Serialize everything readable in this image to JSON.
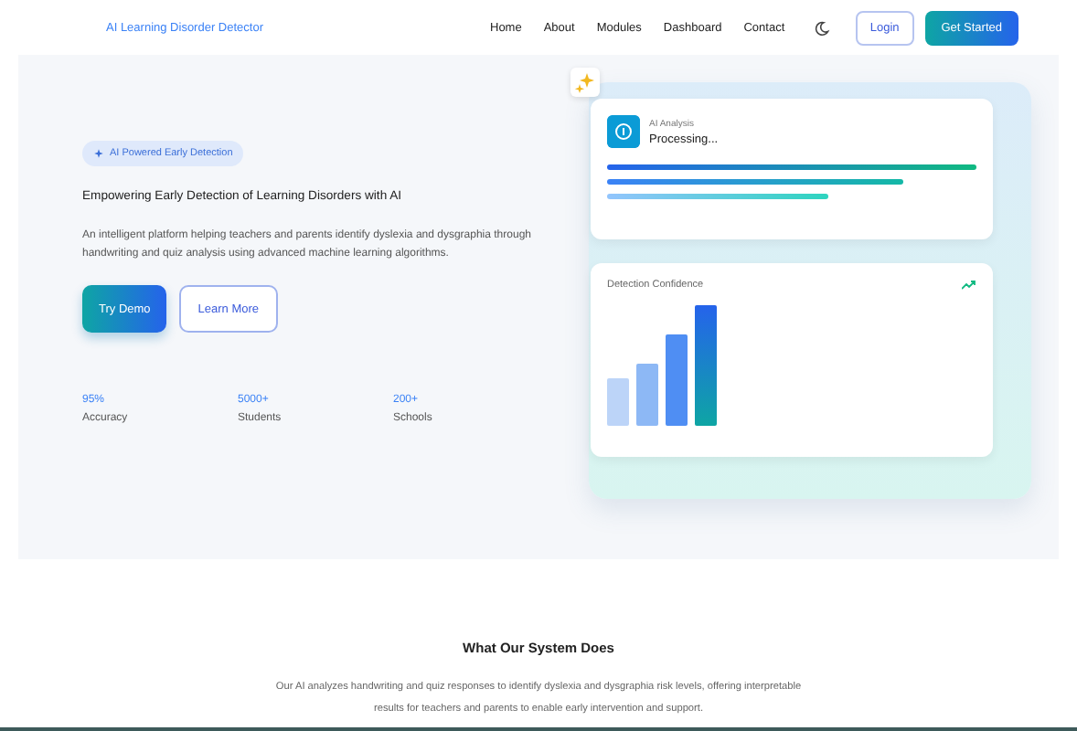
{
  "nav": {
    "brand": "AI Learning Disorder Detector",
    "links": [
      "Home",
      "About",
      "Modules",
      "Dashboard",
      "Contact"
    ],
    "login": "Login",
    "cta": "Get Started"
  },
  "hero": {
    "badge": "AI Powered Early Detection",
    "title": "Empowering Early Detection of Learning Disorders with AI",
    "description": "An intelligent platform helping teachers and parents identify dyslexia and dysgraphia through handwriting and quiz analysis using advanced machine learning algorithms.",
    "buttons": [
      "Try Demo",
      "Learn More"
    ],
    "stats": [
      {
        "value": "95%",
        "label": "Accuracy"
      },
      {
        "value": "5000+",
        "label": "Students"
      },
      {
        "value": "200+",
        "label": "Schools"
      }
    ]
  },
  "preview": {
    "analysis": {
      "label": "AI Analysis",
      "status": "Processing..."
    },
    "chart_title": "Detection Confidence"
  },
  "features": {
    "title": "What Our System Does",
    "description": "Our AI analyzes handwriting and quiz responses to identify dyslexia and dysgraphia risk levels, offering interpretable results for teachers and parents to enable early intervention and support."
  }
}
